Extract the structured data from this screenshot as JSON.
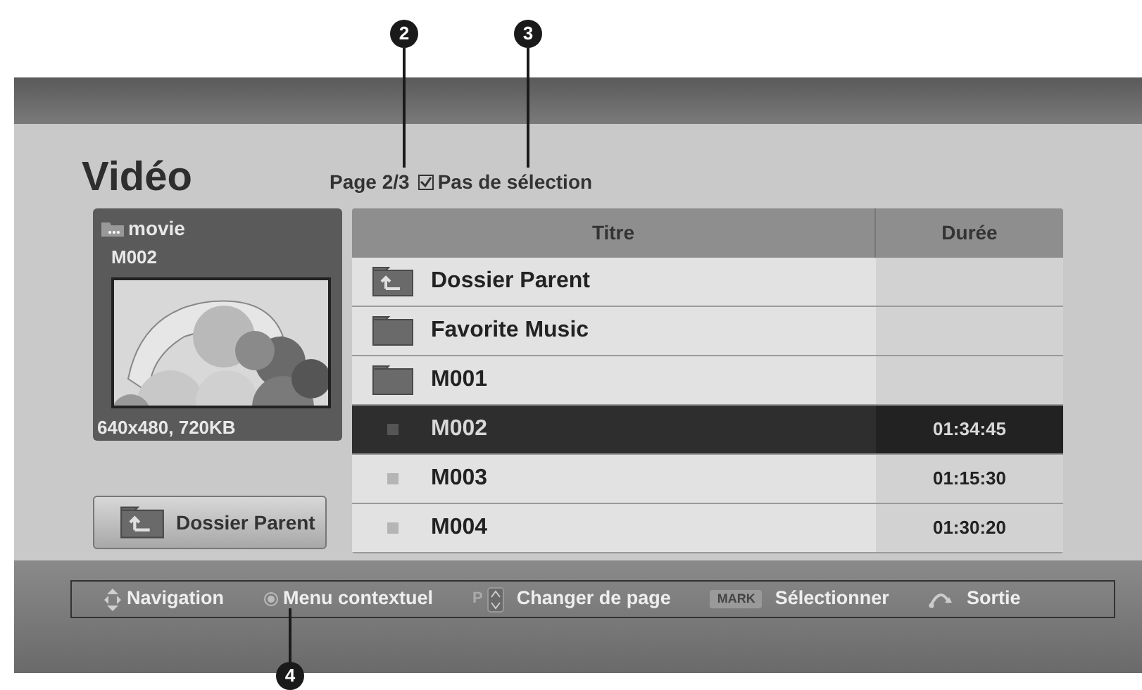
{
  "callouts": [
    {
      "label": "2"
    },
    {
      "label": "3"
    },
    {
      "label": "4"
    }
  ],
  "title": "Vidéo",
  "page": "Page 2/3",
  "selection": {
    "label": "Pas de sélection",
    "checked": true
  },
  "preview": {
    "folder": "movie",
    "name": "M002",
    "info": "640x480, 720KB"
  },
  "parent_button": "Dossier Parent",
  "table": {
    "columns": [
      "Titre",
      "Durée"
    ],
    "rows": [
      {
        "kind": "parent",
        "title": "Dossier Parent",
        "selected": false
      },
      {
        "kind": "folder",
        "title": "Favorite Music",
        "selected": false
      },
      {
        "kind": "folder",
        "title": "M001",
        "selected": false
      },
      {
        "kind": "file",
        "title": "M002",
        "duration": "01:34:45",
        "selected": true
      },
      {
        "kind": "file",
        "title": "M003",
        "duration": "01:15:30",
        "selected": false
      },
      {
        "kind": "file",
        "title": "M004",
        "duration": "01:30:20",
        "selected": false
      }
    ]
  },
  "help_bar": [
    {
      "kind": "navigation",
      "label": "Navigation"
    },
    {
      "kind": "ok",
      "label": "Menu contextuel"
    },
    {
      "kind": "page",
      "key": "P",
      "label": "Changer de page"
    },
    {
      "kind": "mark",
      "key": "MARK",
      "label": "Sélectionner"
    },
    {
      "kind": "exit",
      "label": "Sortie"
    }
  ]
}
